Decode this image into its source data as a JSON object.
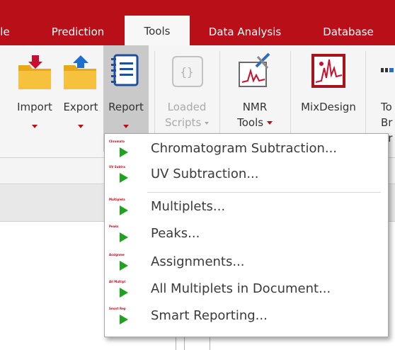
{
  "tabs": [
    {
      "label": "le",
      "active": false
    },
    {
      "label": "Prediction",
      "active": false
    },
    {
      "label": "Tools",
      "active": true
    },
    {
      "label": "Data Analysis",
      "active": false
    },
    {
      "label": "Database",
      "active": false
    }
  ],
  "ribbon": {
    "import": {
      "label": "Import",
      "icon": "folder-import-icon"
    },
    "export": {
      "label": "Export",
      "icon": "folder-export-icon"
    },
    "report": {
      "label": "Report",
      "icon": "report-icon"
    },
    "loaded_scripts": {
      "label_line1": "Loaded",
      "label_line2": "Scripts",
      "icon": "script-scroll-icon"
    },
    "nmr_tools": {
      "label_line1": "NMR",
      "label_line2": "Tools",
      "icon": "nmr-tools-icon"
    },
    "mixdesign": {
      "label": "MixDesign",
      "icon": "mixdesign-icon"
    },
    "partial": {
      "label_line1": "To",
      "label_line2": "Br",
      "label_line3": "Br"
    }
  },
  "menu": {
    "items": [
      {
        "label": "Chromatogram Subtraction...",
        "thumb": "Chromato"
      },
      {
        "label": "UV Subtraction...",
        "thumb": "UV Subtra"
      },
      {
        "label": "Multiplets...",
        "thumb": "Multiplets"
      },
      {
        "label": "Peaks...",
        "thumb": "Peaks"
      },
      {
        "label": "Assignments...",
        "thumb": "Assignme"
      },
      {
        "label": "All Multiplets in Document...",
        "thumb": "All Multipl"
      },
      {
        "label": "Smart Reporting...",
        "thumb": "Smart Rep"
      }
    ]
  },
  "colors": {
    "accent": "#b80f19",
    "play": "#1ea31e",
    "folder": "#f2b732"
  }
}
